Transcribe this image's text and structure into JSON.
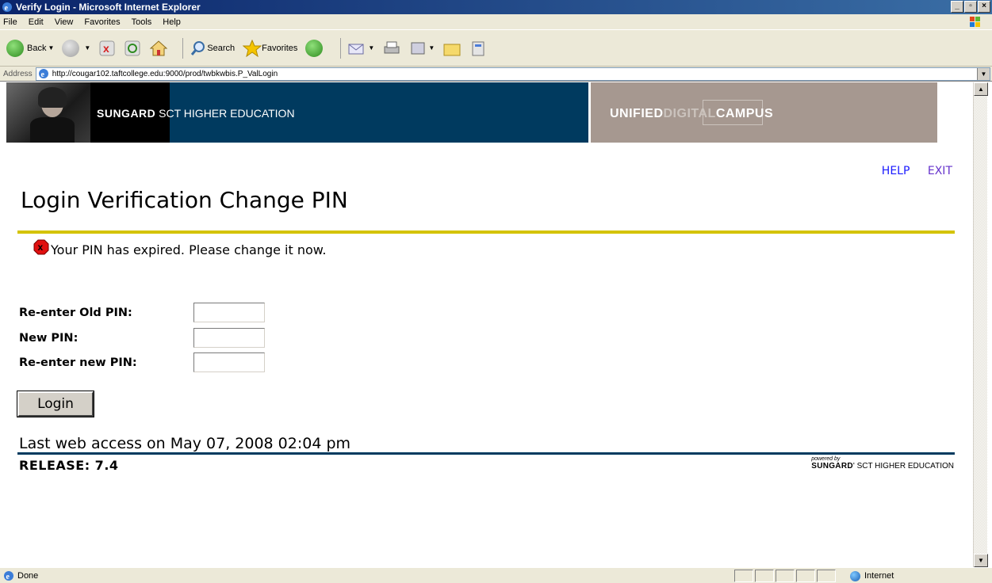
{
  "window": {
    "title": "Verify Login - Microsoft Internet Explorer",
    "minimize_label": "_",
    "maximize_label": "▫",
    "close_label": "×"
  },
  "menubar": {
    "items": [
      "File",
      "Edit",
      "View",
      "Favorites",
      "Tools",
      "Help"
    ]
  },
  "toolbar": {
    "back_label": "Back",
    "search_label": "Search",
    "favorites_label": "Favorites"
  },
  "addressbar": {
    "label": "Address",
    "url": "http://cougar102.taftcollege.edu:9000/prod/twbkwbis.P_ValLogin"
  },
  "banner": {
    "brand_bold": "SUNGARD",
    "brand_rest": " SCT HIGHER EDUCATION",
    "udc_unified": "UNIFIED",
    "udc_digital": "DIGITAL",
    "udc_campus": "CAMPUS"
  },
  "toplinks": {
    "help": "HELP",
    "exit": "EXIT"
  },
  "page": {
    "title": "Login Verification Change PIN",
    "error_message": "Your PIN has expired. Please change it now.",
    "form": {
      "old_pin_label": "Re-enter Old PIN:",
      "new_pin_label": "New PIN:",
      "confirm_pin_label": "Re-enter new PIN:"
    },
    "login_button": "Login",
    "last_access": "Last web access on May 07, 2008 02:04 pm",
    "release": "RELEASE: 7.4",
    "powered_by": "powered by",
    "powered_bold": "SUNGARD",
    "powered_rest": "' SCT HIGHER EDUCATION"
  },
  "statusbar": {
    "status": "Done",
    "zone": "Internet"
  },
  "colors": {
    "banner_blue": "#003a5f",
    "banner_gray": "#a69890",
    "rule_yellow": "#d4c300",
    "link_blue": "#1a1aff"
  }
}
